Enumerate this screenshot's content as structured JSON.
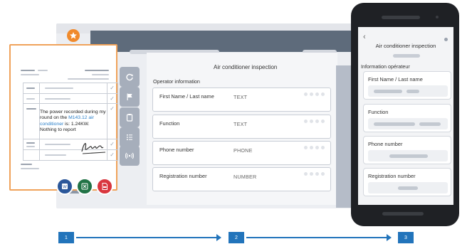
{
  "app": {
    "form_title": "Air conditioner inspection",
    "section_title": "Operator information",
    "fields": [
      {
        "label": "First Name / Last name",
        "type": "TEXT"
      },
      {
        "label": "Function",
        "type": "TEXT"
      },
      {
        "label": "Phone number",
        "type": "PHONE"
      },
      {
        "label": "Registration number",
        "type": "NUMBER"
      }
    ],
    "rail_icons": [
      "refresh-icon",
      "flag-icon",
      "clipboard-icon",
      "checklist-icon",
      "radio-signal-icon"
    ]
  },
  "document": {
    "note_line1": "The power recorded during my round on the ",
    "note_highlight": "M143.12 air conditioner",
    "note_line2": " is: 1.24KW.",
    "note_line3": "Nothing to report",
    "export_formats": [
      "word-icon",
      "excel-icon",
      "pdf-icon"
    ]
  },
  "mobile": {
    "title": "Air conditioner inspection",
    "section_title": "Information opérateur",
    "fields": [
      "First Name / Last name",
      "Function",
      "Phone number",
      "Registration number"
    ]
  },
  "steps": [
    "1",
    "2",
    "3"
  ],
  "colors": {
    "accent_blue": "#2274bb",
    "logo_orange": "#f08a2c",
    "paper_border": "#f0a25a",
    "word": "#2b579a",
    "excel": "#217346",
    "pdf": "#d9363e",
    "header_gray": "#5e6b7b"
  }
}
